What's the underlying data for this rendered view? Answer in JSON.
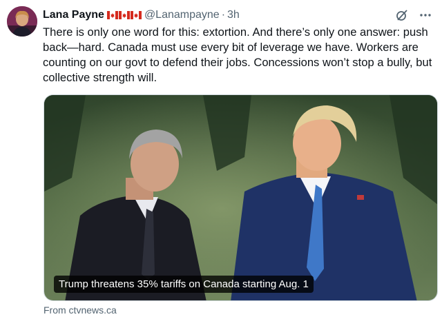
{
  "tweet": {
    "author_name": "Lana Payne",
    "handle": "@Lanampayne",
    "separator": "·",
    "time": "3h",
    "flags": [
      "canada-flag",
      "canada-flag",
      "canada-flag"
    ],
    "text": "There is only one word for this: extortion. And there’s only one answer: push back—hard. Canada must use every bit of leverage we have. Workers are counting on our govt to defend their jobs. Concessions won’t stop a bully, but collective strength will.",
    "actions": {
      "grok_icon": "grok-icon",
      "more_icon": "more-icon"
    }
  },
  "media": {
    "caption": "Trump threatens 35% tariffs on Canada starting Aug. 1",
    "source": "From ctvnews.ca"
  },
  "colors": {
    "text": "#0f1419",
    "secondary": "#536471",
    "flag_red": "#d52b1e"
  }
}
